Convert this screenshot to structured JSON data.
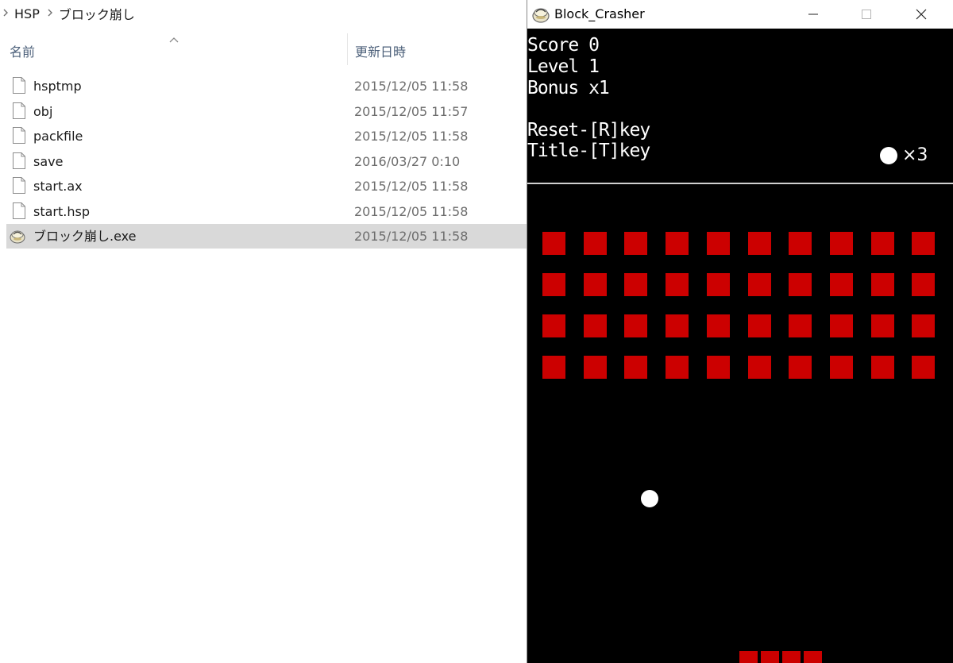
{
  "explorer": {
    "breadcrumb": [
      "HSP",
      "ブロック崩し"
    ],
    "columns": {
      "name": "名前",
      "date": "更新日時"
    },
    "files": [
      {
        "name": "hsptmp",
        "date": "2015/12/05 11:58",
        "icon": "file-icon"
      },
      {
        "name": "obj",
        "date": "2015/12/05 11:57",
        "icon": "file-icon"
      },
      {
        "name": "packfile",
        "date": "2015/12/05 11:58",
        "icon": "file-icon"
      },
      {
        "name": "save",
        "date": "2016/03/27 0:10",
        "icon": "file-icon"
      },
      {
        "name": "start.ax",
        "date": "2015/12/05 11:58",
        "icon": "file-icon"
      },
      {
        "name": "start.hsp",
        "date": "2015/12/05 11:58",
        "icon": "file-icon"
      },
      {
        "name": "ブロック崩し.exe",
        "date": "2015/12/05 11:58",
        "icon": "hsp-exe-icon",
        "selected": true
      }
    ]
  },
  "game": {
    "window_title": "Block_Crasher",
    "hud": {
      "score": "Score 0",
      "level": "Level 1",
      "bonus": "Bonus x1",
      "reset_hint": "Reset-[R]key",
      "title_hint": "Title-[T]key",
      "lives": "×3"
    },
    "bricks": {
      "rows": 4,
      "columns": 10,
      "color": "#cc0000"
    },
    "paddle_segments": 4,
    "colors": {
      "background": "#000000",
      "foreground": "#ffffff",
      "brick": "#cc0000"
    }
  }
}
